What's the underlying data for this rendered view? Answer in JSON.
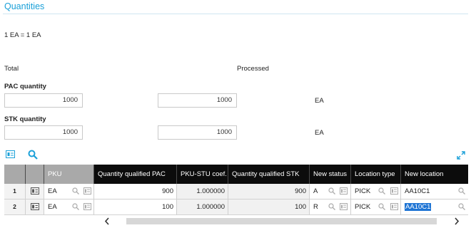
{
  "section_title": "Quantities",
  "unit_conversion": "1 EA = 1 EA",
  "totals": {
    "total_label": "Total",
    "processed_label": "Processed"
  },
  "pac": {
    "label": "PAC quantity",
    "total_value": "1000",
    "processed_value": "1000",
    "unit": "EA"
  },
  "stk": {
    "label": "STK quantity",
    "total_value": "1000",
    "processed_value": "1000",
    "unit": "EA"
  },
  "grid": {
    "columns": [
      "PKU",
      "Quantity qualified PAC",
      "PKU-STU coef.",
      "Quantity qualified STK",
      "New status",
      "Location type",
      "New location"
    ],
    "rows": [
      {
        "num": "1",
        "pku": "EA",
        "qty_pac": "900",
        "coef": "1.000000",
        "qty_stk": "900",
        "status": "A",
        "loc_type": "PICK",
        "location": "AA10C1"
      },
      {
        "num": "2",
        "pku": "EA",
        "qty_pac": "100",
        "coef": "1.000000",
        "qty_stk": "100",
        "status": "R",
        "loc_type": "PICK",
        "location": "AA10C1"
      }
    ]
  },
  "icons": {
    "list_view": "list-view-icon",
    "search": "search-icon",
    "expand": "expand-icon",
    "row_detail": "row-detail-icon",
    "lookup": "lookup-icon",
    "selection": "selection-list-icon",
    "scroll_left": "chevron-left-icon",
    "scroll_right": "chevron-right-icon"
  },
  "colors": {
    "accent": "#1aa0d8",
    "header_dark": "#0c0c0c",
    "header_grey": "#a9a9a9",
    "selection": "#1e74d4"
  }
}
